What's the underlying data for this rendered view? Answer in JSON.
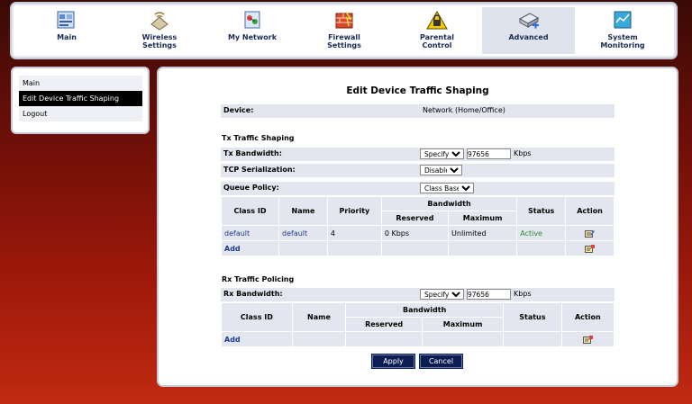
{
  "nav": [
    {
      "label": "Main",
      "icon": "main-icon",
      "active": false
    },
    {
      "label": "Wireless\nSettings",
      "icon": "wireless-icon",
      "active": false
    },
    {
      "label": "My Network",
      "icon": "my-network-icon",
      "active": false
    },
    {
      "label": "Firewall\nSettings",
      "icon": "firewall-icon",
      "active": false
    },
    {
      "label": "Parental\nControl",
      "icon": "parental-control-icon",
      "active": false
    },
    {
      "label": "Advanced",
      "icon": "advanced-icon",
      "active": true
    },
    {
      "label": "System\nMonitoring",
      "icon": "system-monitoring-icon",
      "active": false
    }
  ],
  "sidebar": {
    "items": [
      {
        "label": "Main"
      },
      {
        "label": "Edit Device Traffic Shaping",
        "selected": true
      },
      {
        "label": "Logout"
      }
    ]
  },
  "page": {
    "title": "Edit Device Traffic Shaping",
    "device_label": "Device:",
    "device_value": "Network (Home/Office)"
  },
  "tx": {
    "section_title": "Tx Traffic Shaping",
    "bandwidth_label": "Tx Bandwidth:",
    "bandwidth_mode": "Specify",
    "bandwidth_value": "97656",
    "bandwidth_unit": "Kbps",
    "tcp_label": "TCP Serialization:",
    "tcp_value": "Disabled",
    "queue_label": "Queue Policy:",
    "queue_value": "Class Based",
    "table": {
      "headers": {
        "class_id": "Class ID",
        "name": "Name",
        "priority": "Priority",
        "bandwidth": "Bandwidth",
        "reserved": "Reserved",
        "maximum": "Maximum",
        "status": "Status",
        "action": "Action"
      },
      "rows": [
        {
          "class_id": "default",
          "name": "default",
          "priority": "4",
          "reserved": "0 Kbps",
          "maximum": "Unlimited",
          "status": "Active"
        }
      ],
      "add_label": "Add"
    }
  },
  "rx": {
    "section_title": "Rx Traffic Policing",
    "bandwidth_label": "Rx Bandwidth:",
    "bandwidth_mode": "Specify",
    "bandwidth_value": "97656",
    "bandwidth_unit": "Kbps",
    "table": {
      "headers": {
        "class_id": "Class ID",
        "name": "Name",
        "bandwidth": "Bandwidth",
        "reserved": "Reserved",
        "maximum": "Maximum",
        "status": "Status",
        "action": "Action"
      },
      "add_label": "Add"
    }
  },
  "buttons": {
    "apply": "Apply",
    "cancel": "Cancel"
  },
  "colors": {
    "accent": "#0b1d52",
    "active_status": "#2a8a2a",
    "link": "#1a3a8c"
  }
}
